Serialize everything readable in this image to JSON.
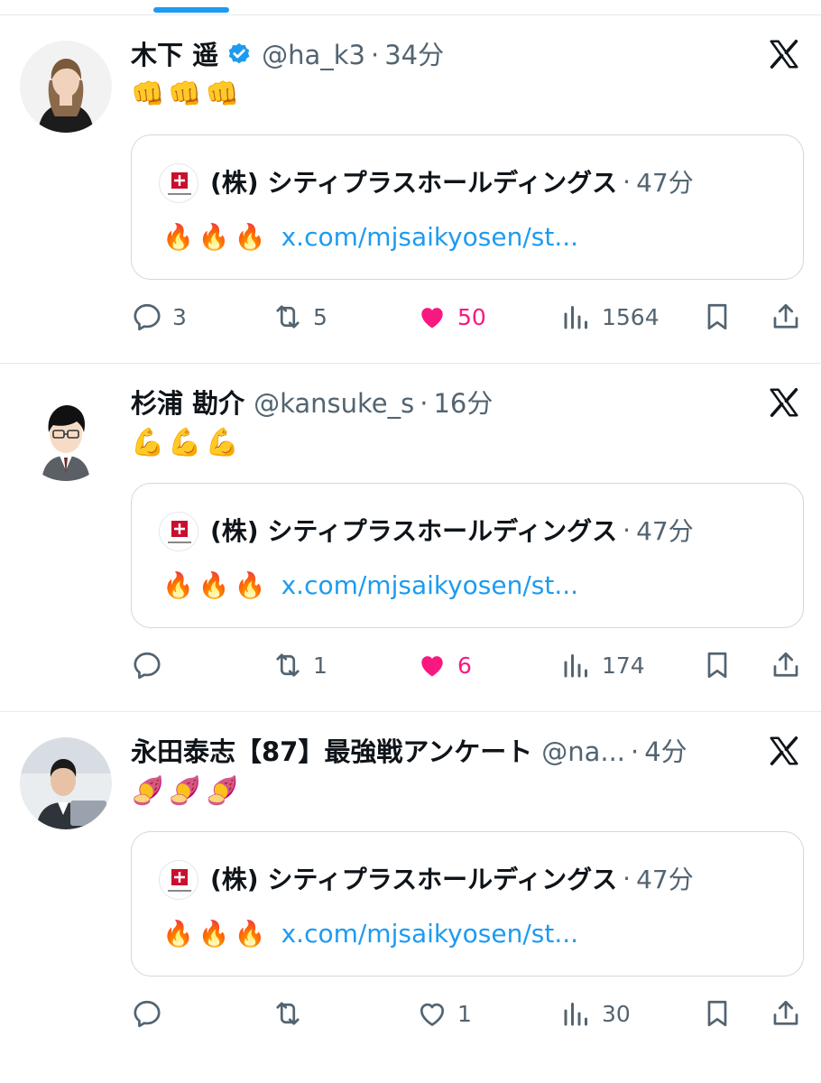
{
  "colors": {
    "accent": "#1d9bf0",
    "like": "#f91880",
    "secondary_text": "#536471",
    "verified": "#1d9bf0"
  },
  "tweets": [
    {
      "display_name": "木下 遥",
      "verified": true,
      "handle": "@ha_k3",
      "separator": "·",
      "time": "34分",
      "text": "👊👊👊",
      "quote": {
        "name": "(株) シティプラスホールディングス",
        "separator": "·",
        "time": "47分",
        "emoji": "🔥🔥🔥",
        "link": "x.com/mjsaikyosen/st..."
      },
      "actions": {
        "replies": "3",
        "retweets": "5",
        "likes": "50",
        "liked": true,
        "views": "1564"
      }
    },
    {
      "display_name": "杉浦 勘介",
      "verified": false,
      "handle": "@kansuke_s",
      "separator": "·",
      "time": "16分",
      "text": "💪💪💪",
      "quote": {
        "name": "(株) シティプラスホールディングス",
        "separator": "·",
        "time": "47分",
        "emoji": "🔥🔥🔥",
        "link": "x.com/mjsaikyosen/st..."
      },
      "actions": {
        "replies": "",
        "retweets": "1",
        "likes": "6",
        "liked": true,
        "views": "174"
      }
    },
    {
      "display_name": "永田泰志【87】最強戦アンケート",
      "verified": false,
      "handle": "@na...",
      "separator": "·",
      "time": "4分",
      "text": "🍠🍠🍠",
      "quote": {
        "name": "(株) シティプラスホールディングス",
        "separator": "·",
        "time": "47分",
        "emoji": "🔥🔥🔥",
        "link": "x.com/mjsaikyosen/st..."
      },
      "actions": {
        "replies": "",
        "retweets": "",
        "likes": "1",
        "liked": false,
        "views": "30"
      }
    }
  ],
  "icons": {
    "reply": "reply-icon",
    "retweet": "retweet-icon",
    "like": "heart-icon",
    "views": "views-icon",
    "bookmark": "bookmark-icon",
    "share": "share-icon",
    "brand": "x-logo-icon"
  }
}
